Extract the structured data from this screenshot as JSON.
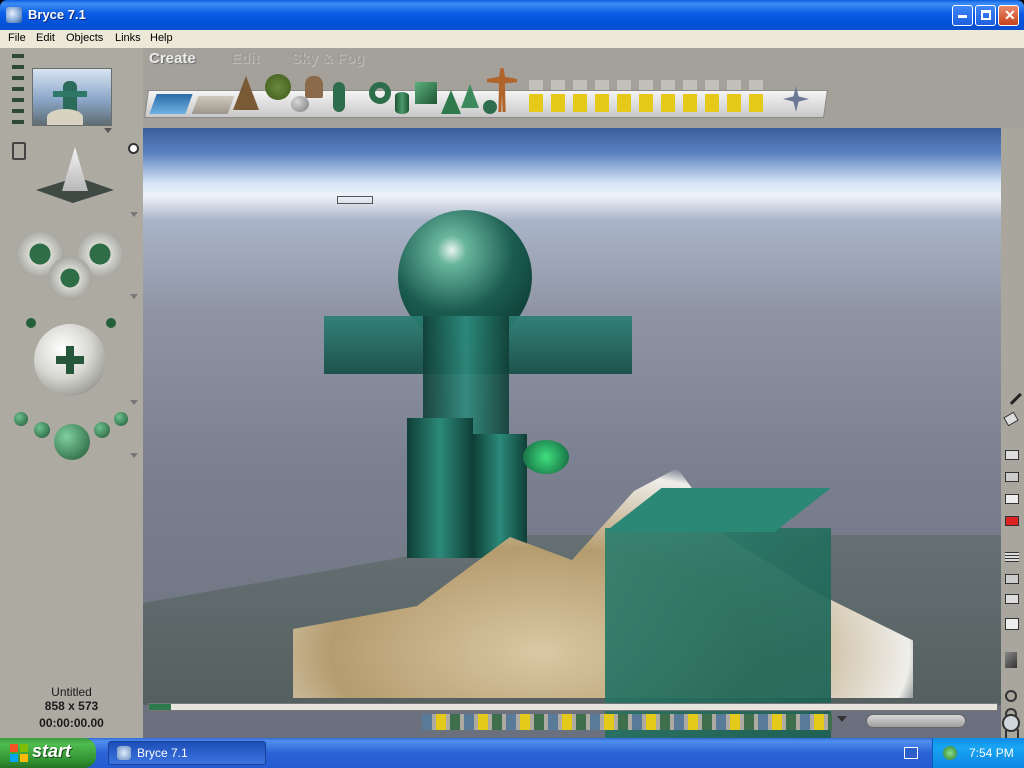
{
  "window": {
    "title": "Bryce 7.1"
  },
  "menu": [
    "File",
    "Edit",
    "Objects",
    "Links",
    "Help"
  ],
  "palette_tabs": {
    "create": "Create",
    "edit": "Edit",
    "sky_fog": "Sky & Fog"
  },
  "status": {
    "document": "Untitled",
    "size": "858 x 573",
    "timecode": "00:00:00.00"
  },
  "taskbar": {
    "start_label": "start",
    "task_label": "Bryce 7.1",
    "clock": "7:54 PM"
  }
}
